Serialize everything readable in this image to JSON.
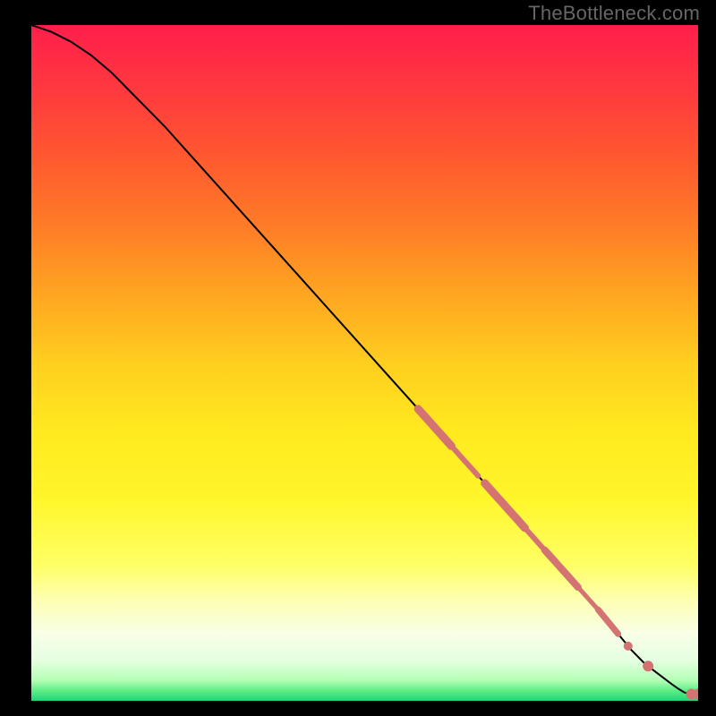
{
  "watermark": "TheBottleneck.com",
  "gradient": {
    "stops": [
      {
        "offset": 0.0,
        "color": "#ff1e4b"
      },
      {
        "offset": 0.1,
        "color": "#ff3a3e"
      },
      {
        "offset": 0.2,
        "color": "#ff5a2f"
      },
      {
        "offset": 0.3,
        "color": "#ff7d27"
      },
      {
        "offset": 0.4,
        "color": "#ffa621"
      },
      {
        "offset": 0.5,
        "color": "#ffce1f"
      },
      {
        "offset": 0.6,
        "color": "#ffe91f"
      },
      {
        "offset": 0.7,
        "color": "#fff62a"
      },
      {
        "offset": 0.8,
        "color": "#ffff66"
      },
      {
        "offset": 0.85,
        "color": "#fdffb1"
      },
      {
        "offset": 0.9,
        "color": "#f8ffe6"
      },
      {
        "offset": 0.94,
        "color": "#e6ffe0"
      },
      {
        "offset": 0.97,
        "color": "#b2ffb4"
      },
      {
        "offset": 0.985,
        "color": "#5eed87"
      },
      {
        "offset": 1.0,
        "color": "#17d977"
      }
    ]
  },
  "chart_data": {
    "type": "line",
    "title": "",
    "xlabel": "",
    "ylabel": "",
    "xlim": [
      0,
      100
    ],
    "ylim": [
      0,
      100
    ],
    "series": [
      {
        "name": "curve",
        "x": [
          0,
          3,
          6,
          9,
          12,
          15,
          20,
          25,
          30,
          35,
          40,
          45,
          50,
          55,
          60,
          65,
          70,
          75,
          80,
          85,
          90,
          92,
          94,
          96,
          97,
          98,
          99,
          100
        ],
        "y": [
          100,
          99,
          97.5,
          95.5,
          93,
          90,
          85,
          79.5,
          74,
          68.5,
          63,
          57.5,
          52,
          46.5,
          41,
          35.5,
          30,
          24.5,
          19,
          13.5,
          7.5,
          5.5,
          4,
          2.5,
          1.8,
          1.2,
          1.0,
          1.0
        ]
      }
    ],
    "marker_clusters": [
      {
        "start_x": 58,
        "end_x": 63,
        "thickness": 9
      },
      {
        "start_x": 63,
        "end_x": 67,
        "thickness": 6
      },
      {
        "start_x": 68,
        "end_x": 74,
        "thickness": 9
      },
      {
        "start_x": 74,
        "end_x": 77,
        "thickness": 6
      },
      {
        "start_x": 77,
        "end_x": 82,
        "thickness": 8
      },
      {
        "start_x": 82,
        "end_x": 85,
        "thickness": 5
      },
      {
        "start_x": 85,
        "end_x": 88,
        "thickness": 7
      }
    ],
    "single_markers": [
      {
        "x": 89.5,
        "r": 5
      },
      {
        "x": 92.5,
        "r": 6
      },
      {
        "x": 99,
        "r": 6
      },
      {
        "x": 100,
        "r": 6
      }
    ],
    "marker_color": "#d57272"
  }
}
